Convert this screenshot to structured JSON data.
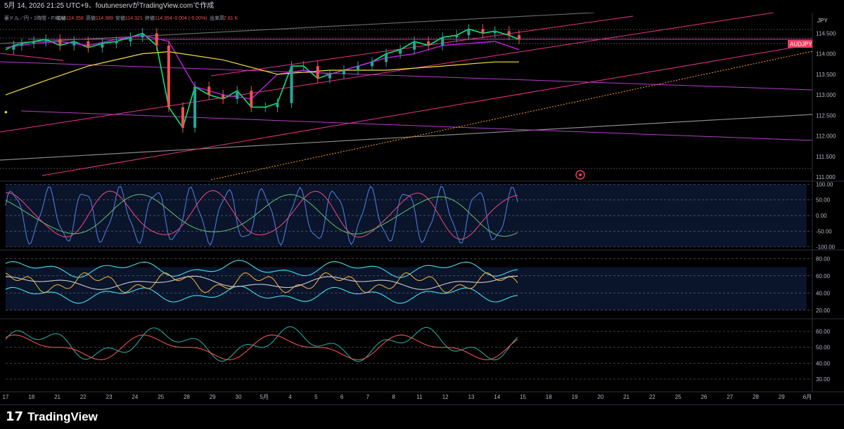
{
  "header": {
    "capture_line": "5月 14, 2026 21:25 UTC+9、foutuneservがTradingView.comで作成"
  },
  "legend": {
    "symbol": "豪ドル／円・1時間・FXCM",
    "open_label": "始値",
    "open": "114.358",
    "high_label": "高値",
    "high": "114.389",
    "low_label": "安値",
    "low": "114.321",
    "close_label": "終値",
    "close": "114.354",
    "change": "-0.004 (-0.00%)",
    "volume_label": "出来高",
    "volume": "7.81 K"
  },
  "currency": "JPY",
  "price_tag": "AUDJPY",
  "colors": {
    "background": "#000000",
    "price_line_green": "#00e676",
    "candle_up": "#26a69a",
    "candle_down": "#ef5350",
    "magenta": "#c020e0",
    "yellow_ma": "#f7e23b",
    "purple_channel": "#b43cc8",
    "pink_channel": "#e8338a",
    "black_trend": "#444444",
    "orange_dashed": "#ff9f1a",
    "oscillator_band": "#1e3a7a"
  },
  "chart_data": [
    {
      "type": "line",
      "pane": "price",
      "title": "豪ドル／円・1時間・FXCM",
      "ylabel": "JPY",
      "ylim": [
        110.9,
        115.0
      ],
      "y_ticks": [
        "114.500",
        "114.000",
        "113.500",
        "113.000",
        "112.500",
        "112.000",
        "111.500",
        "111.000"
      ],
      "last_price_tag": "AUDJPY",
      "series": [
        {
          "x": [
            0,
            4,
            8,
            14,
            20,
            27,
            34,
            41,
            48,
            55,
            62,
            68,
            75,
            81,
            88,
            94,
            101,
            108,
            115,
            122,
            129,
            135,
            142,
            148,
            155,
            161,
            168,
            175,
            182,
            189,
            196,
            203,
            210,
            217,
            224,
            230,
            237,
            243,
            250,
            255
          ],
          "values": [
            114.1,
            114.2,
            114.25,
            114.3,
            114.35,
            114.2,
            114.3,
            114.15,
            114.25,
            114.3,
            114.4,
            114.5,
            114.2,
            112.7,
            112.2,
            113.2,
            113.0,
            112.9,
            113.1,
            112.7,
            112.7,
            112.8,
            113.7,
            113.7,
            113.4,
            113.5,
            113.6,
            113.7,
            113.8,
            114.0,
            114.1,
            114.3,
            114.2,
            114.4,
            114.45,
            114.6,
            114.5,
            114.55,
            114.45,
            114.35
          ]
        },
        {
          "x": [
            0,
            14,
            27,
            41,
            55,
            68,
            81,
            94,
            108,
            122,
            135,
            148,
            161,
            175,
            189,
            203,
            217,
            230,
            243,
            255
          ],
          "values": [
            114.15,
            114.25,
            114.3,
            114.2,
            114.35,
            114.45,
            114.3,
            113.2,
            113.0,
            112.9,
            113.5,
            113.6,
            113.5,
            113.7,
            113.9,
            114.0,
            114.2,
            114.25,
            114.3,
            114.1
          ]
        },
        {
          "x": [
            0,
            20,
            41,
            68,
            81,
            108,
            135,
            161,
            189,
            217,
            243,
            255
          ],
          "values": [
            113.0,
            113.35,
            113.7,
            114.0,
            114.05,
            113.85,
            113.5,
            113.6,
            113.6,
            113.7,
            113.8,
            113.8
          ]
        }
      ],
      "annotation": "●"
    },
    {
      "type": "line",
      "pane": "oscillator_1",
      "ylim": [
        -110,
        110
      ],
      "y_ticks": [
        "100.00",
        "50.00",
        "0.00",
        "-50.00",
        "-100.00"
      ],
      "band": [
        -100,
        100
      ]
    },
    {
      "type": "line",
      "pane": "oscillator_2",
      "ylim": [
        10,
        90
      ],
      "y_ticks": [
        "80.00",
        "60.00",
        "40.00",
        "20.00"
      ],
      "band": [
        20,
        70
      ]
    },
    {
      "type": "area",
      "pane": "oscillator_3",
      "ylim": [
        22,
        68
      ],
      "y_ticks": [
        "60.00",
        "50.00",
        "40.00",
        "30.00"
      ],
      "reference_lines": [
        60,
        50,
        40
      ]
    }
  ],
  "x_axis": {
    "ticks": [
      "17",
      "18",
      "21",
      "22",
      "23",
      "24",
      "25",
      "28",
      "29",
      "30",
      "5月",
      "4",
      "5",
      "6",
      "7",
      "8",
      "11",
      "12",
      "13",
      "14",
      "15",
      "18",
      "19",
      "20",
      "21",
      "22",
      "25",
      "26",
      "27",
      "28",
      "29",
      "6月"
    ]
  }
}
